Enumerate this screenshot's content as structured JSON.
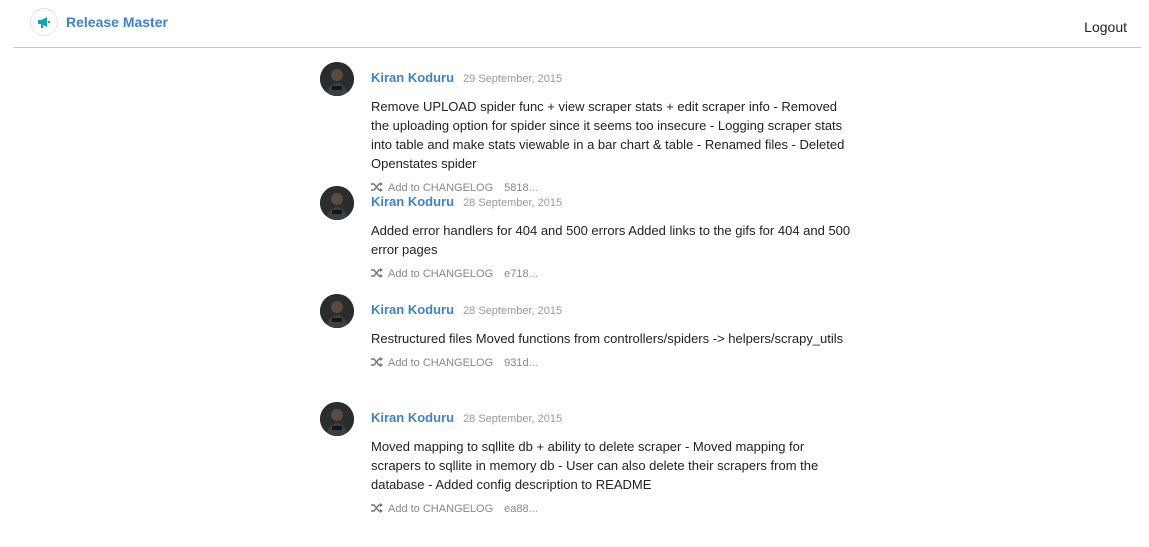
{
  "app": {
    "brand_name": "Release Master",
    "brand_icon": "megaphone-icon",
    "logout_label": "Logout",
    "accent_color": "#3d84c6",
    "logo_color": "#17a2b8"
  },
  "commits": [
    {
      "author": "Kiran Koduru",
      "date": "29 September, 2015",
      "message": "Remove UPLOAD spider func + view scraper stats + edit scraper info - Removed the uploading option for spider since it seems too insecure - Logging scraper stats into table and make stats viewable in a bar chart & table - Renamed files - Deleted Openstates spider",
      "action_label": "Add to CHANGELOG",
      "action_icon": "shuffle-icon",
      "sha": "5818..."
    },
    {
      "author": "Kiran Koduru",
      "date": "28 September, 2015",
      "message": "Added error handlers for 404 and 500 errors Added links to the gifs for 404 and 500 error pages",
      "action_label": "Add to CHANGELOG",
      "action_icon": "shuffle-icon",
      "sha": "e718..."
    },
    {
      "author": "Kiran Koduru",
      "date": "28 September, 2015",
      "message": "Restructured files Moved functions from controllers/spiders -> helpers/scrapy_utils",
      "action_label": "Add to CHANGELOG",
      "action_icon": "shuffle-icon",
      "sha": "931d..."
    },
    {
      "author": "Kiran Koduru",
      "date": "28 September, 2015",
      "message": "Moved mapping to sqllite db + ability to delete scraper - Moved mapping for scrapers to sqllite in memory db - User can also delete their scrapers from the database - Added config description to README",
      "action_label": "Add to CHANGELOG",
      "action_icon": "shuffle-icon",
      "sha": "ea88..."
    }
  ]
}
